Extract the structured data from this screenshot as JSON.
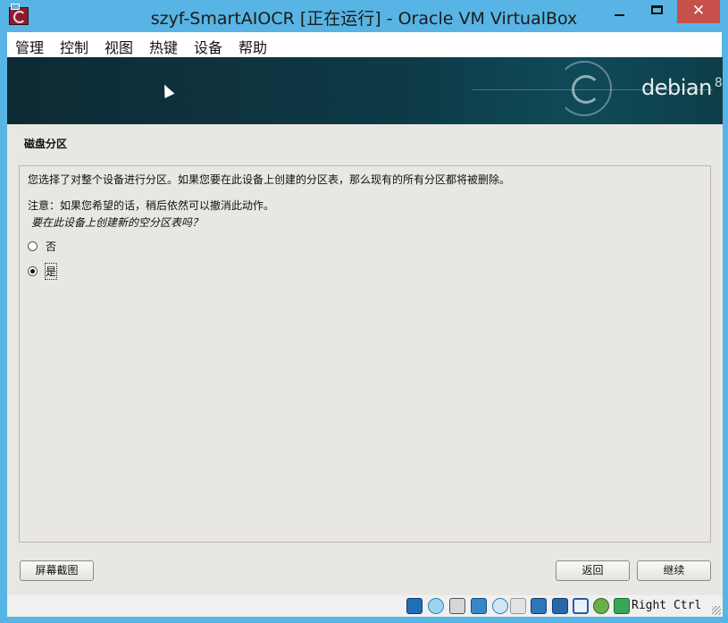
{
  "window": {
    "title": "szyf-SmartAIOCR [正在运行] - Oracle VM VirtualBox",
    "close_glyph": "✕"
  },
  "menu": {
    "items": [
      "管理",
      "控制",
      "视图",
      "热键",
      "设备",
      "帮助"
    ]
  },
  "banner": {
    "brand": "debian",
    "version": "8"
  },
  "installer": {
    "section_title": "磁盘分区",
    "line1": "您选择了对整个设备进行分区。如果您要在此设备上创建的分区表，那么现有的所有分区都将被删除。",
    "line2": "注意：如果您希望的话，稍后依然可以撤消此动作。",
    "question": "要在此设备上创建新的空分区表吗？",
    "options": [
      {
        "label": "否",
        "selected": false
      },
      {
        "label": "是",
        "selected": true
      }
    ],
    "buttons": {
      "screenshot": "屏幕截图",
      "back": "返回",
      "continue": "继续"
    }
  },
  "statusbar": {
    "host_key": "Right Ctrl",
    "icons": [
      "hard-disk-icon",
      "optical-drive-icon",
      "audio-icon",
      "network-icon",
      "usb-icon",
      "shared-folder-icon",
      "display-icon",
      "video-capture-icon",
      "virtualization-icon",
      "mouse-integration-icon",
      "keyboard-capture-icon"
    ]
  },
  "colors": {
    "titlebar": "#58b4e4",
    "close_button": "#c7504b",
    "vm_background": "#e8e7e2",
    "banner": "#0e3a47"
  }
}
